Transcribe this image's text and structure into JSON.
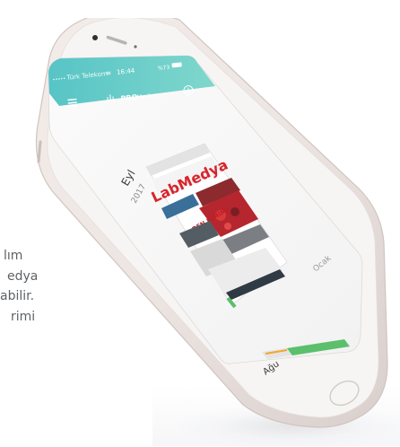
{
  "side_text": {
    "line1": "lım",
    "line2": "edya",
    "line3": "abilir.",
    "line4": "rimi"
  },
  "status_bar": {
    "carrier": "Türk Telekom",
    "time": "16:44",
    "battery": "%73"
  },
  "nav_bar": {
    "brand_letters": "ılı",
    "brand_name": "PRO",
    "brand_suffix": "Medya"
  },
  "content": {
    "month_label": "Eyl",
    "year_label": "2017",
    "right_label": "Ocak",
    "bottom_label": "Ağu",
    "magazine_title": "LabMedya",
    "headline": "BEN KİMİM?"
  },
  "colors": {
    "accent": "#4cc7c3",
    "magazine_red": "#d8242c",
    "phone_body": "#eae3e0",
    "side_text": "#5e6266",
    "progress_green": "#5cbf6b"
  }
}
